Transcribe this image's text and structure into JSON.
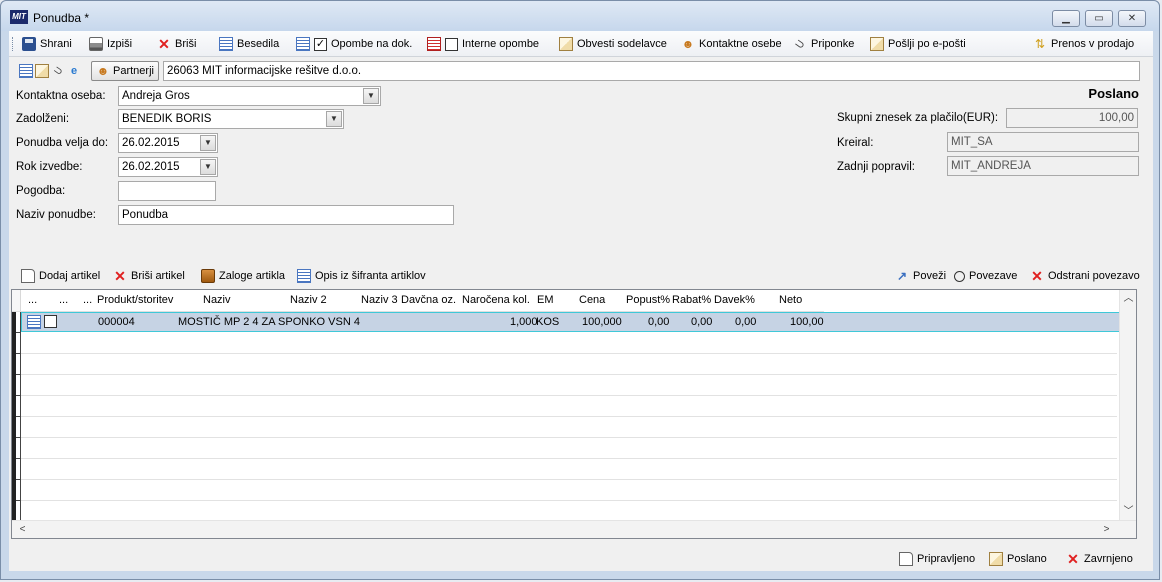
{
  "window": {
    "title": "Ponudba *",
    "logo_text": "MIT",
    "controls": [
      "minimize",
      "maximize",
      "close"
    ]
  },
  "toolbar": {
    "save": "Shrani",
    "print": "Izpiši",
    "delete": "Briši",
    "texts": "Besedila",
    "notes_doc": "Opombe na dok.",
    "notes_doc_checked": true,
    "internal_notes": "Interne opombe",
    "internal_notes_checked": false,
    "notify": "Obvesti sodelavce",
    "contacts": "Kontaktne osebe",
    "attachments": "Priponke",
    "send_email": "Pošlji po e-pošti",
    "transfer": "Prenos v prodajo"
  },
  "partner": {
    "button": "Partnerji",
    "value": "26063 MIT informacijske rešitve d.o.o."
  },
  "form": {
    "contact_label": "Kontaktna oseba:",
    "contact_value": "Andreja Gros",
    "assigned_label": "Zadolženi:",
    "assigned_value": "BENEDIK BORIS",
    "valid_label": "Ponudba velja do:",
    "valid_value": "26.02.2015",
    "deadline_label": "Rok izvedbe:",
    "deadline_value": "26.02.2015",
    "contract_label": "Pogodba:",
    "contract_value": "",
    "name_label": "Naziv ponudbe:",
    "name_value": "Ponudba"
  },
  "status": {
    "title": "Poslano",
    "total_label": "Skupni znesek za plačilo(EUR):",
    "total_value": "100,00",
    "created_label": "Kreiral:",
    "created_value": "MIT_SA",
    "modified_label": "Zadnji popravil:",
    "modified_value": "MIT_ANDREJA"
  },
  "grid_toolbar": {
    "add": "Dodaj artikel",
    "delete": "Briši artikel",
    "stock": "Zaloge artikla",
    "desc": "Opis iz šifranta artiklov",
    "link": "Poveži",
    "links": "Povezave",
    "unlink": "Odstrani povezavo"
  },
  "grid": {
    "headers": [
      "...",
      "...",
      "...",
      "Produkt/storitev",
      "Naziv",
      "Naziv 2",
      "Naziv 3",
      "Davčna oz.",
      "Naročena kol.",
      "EM",
      "Cena",
      "Popust%",
      "Rabat%",
      "Davek%",
      "Neto"
    ],
    "rows": [
      {
        "product": "000004",
        "name": "MOSTIČ MP 2 4  ZA SPONKO VSN 4",
        "qty": "1,000",
        "unit": "KOS",
        "price": "100,000",
        "discount": "0,00",
        "rebate": "0,00",
        "tax": "0,00",
        "net": "100,00"
      }
    ]
  },
  "bottom": {
    "prepared": "Pripravljeno",
    "sent": "Poslano",
    "rejected": "Zavrnjeno"
  }
}
